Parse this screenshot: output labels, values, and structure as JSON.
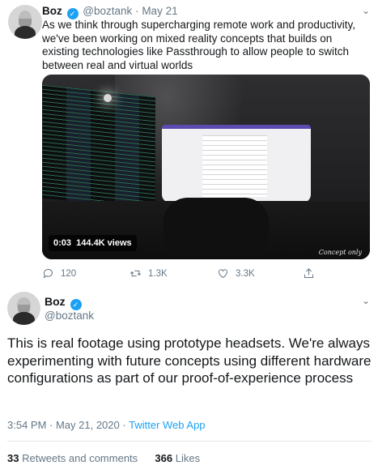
{
  "tweet1": {
    "name": "Boz",
    "handle": "@boztank",
    "separator": "·",
    "date": "May 21",
    "text": "As we think through supercharging remote work and productivity, we've been working on mixed reality concepts that builds on existing technologies like Passthrough to allow people to switch between real and virtual worlds",
    "video": {
      "time": "0:03",
      "views": "144.4K views",
      "watermark": "Concept only"
    },
    "actions": {
      "replies": "120",
      "retweets": "1.3K",
      "likes": "3.3K"
    }
  },
  "tweet2": {
    "name": "Boz",
    "handle": "@boztank",
    "text": "This is real footage using prototype headsets. We're always experimenting with future concepts using different hardware configurations as part of our proof-of-experience process",
    "timestamp": "3:54 PM · May 21, 2020",
    "meta_separator": "·",
    "source": "Twitter Web App",
    "retweets_count": "33",
    "retweets_label": "Retweets and comments",
    "likes_count": "366",
    "likes_label": "Likes"
  },
  "icons": {
    "verified": "verified-badge-icon",
    "reply": "reply-icon",
    "retweet": "retweet-icon",
    "like": "heart-icon",
    "share": "share-icon",
    "more": "chevron-down-icon"
  },
  "colors": {
    "accent": "#1da1f2",
    "text": "#14171a",
    "muted": "#657786",
    "border": "#e1e8ed"
  }
}
